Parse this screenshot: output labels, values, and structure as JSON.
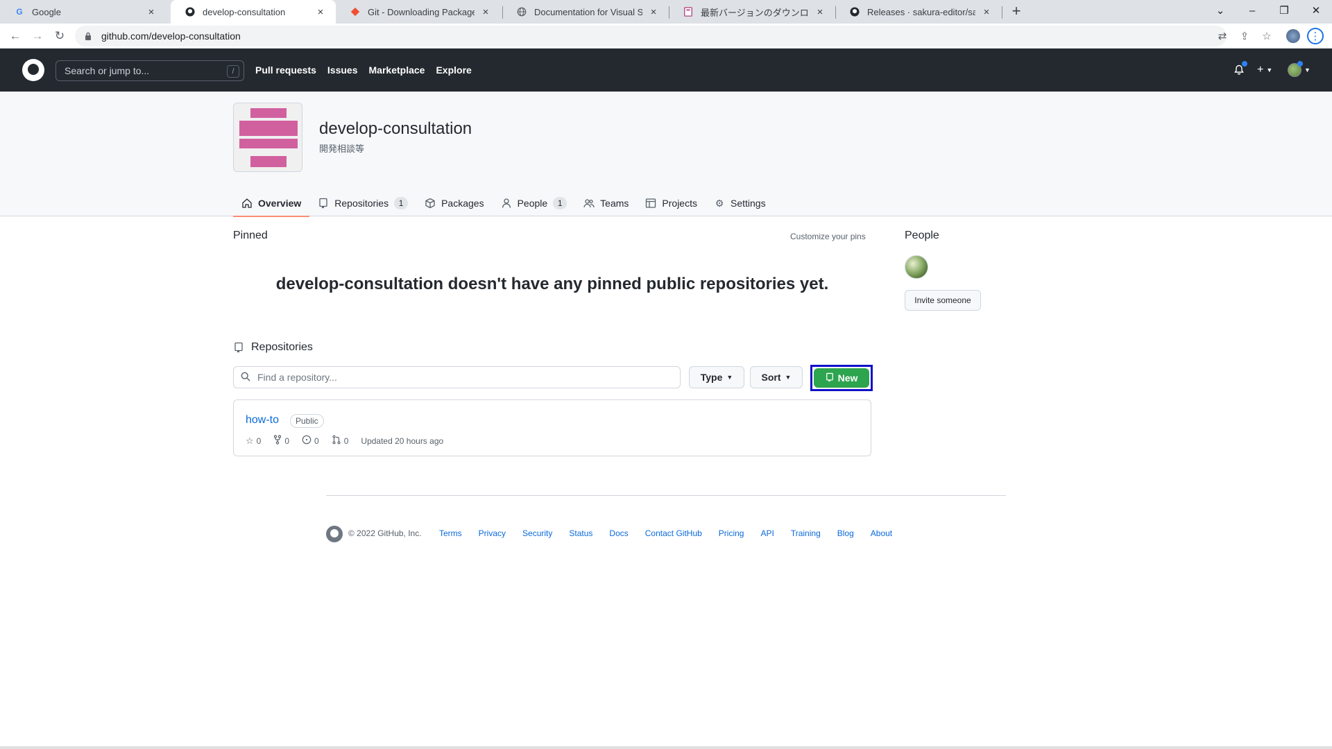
{
  "browser": {
    "tabs": [
      {
        "title": "Google",
        "favicon": "G"
      },
      {
        "title": "develop-consultation",
        "favicon": "github-icon"
      },
      {
        "title": "Git - Downloading Package",
        "favicon": "git-icon"
      },
      {
        "title": "Documentation for Visual Studio",
        "favicon": "globe-icon"
      },
      {
        "title": "最新バージョンのダウンロード",
        "favicon": "page-icon"
      },
      {
        "title": "Releases · sakura-editor/sakura",
        "favicon": "github-icon"
      }
    ],
    "url": "github.com/develop-consultation"
  },
  "header": {
    "search_placeholder": "Search or jump to...",
    "search_shortcut": "/",
    "nav": [
      "Pull requests",
      "Issues",
      "Marketplace",
      "Explore"
    ]
  },
  "org": {
    "name": "develop-consultation",
    "description": "開発相談等",
    "avatar_color": "#d1609f",
    "tabs": [
      {
        "label": "Overview",
        "icon": "home-icon"
      },
      {
        "label": "Repositories",
        "icon": "repo-icon",
        "count": "1"
      },
      {
        "label": "Packages",
        "icon": "package-icon"
      },
      {
        "label": "People",
        "icon": "person-icon",
        "count": "1"
      },
      {
        "label": "Teams",
        "icon": "people-icon"
      },
      {
        "label": "Projects",
        "icon": "table-icon"
      },
      {
        "label": "Settings",
        "icon": "gear-icon"
      }
    ]
  },
  "pinned": {
    "title": "Pinned",
    "customize": "Customize your pins",
    "empty_message": "develop-consultation doesn't have any pinned public repositories yet."
  },
  "repositories": {
    "title": "Repositories",
    "search_placeholder": "Find a repository...",
    "type_label": "Type",
    "sort_label": "Sort",
    "new_label": "New",
    "items": [
      {
        "name": "how-to",
        "visibility": "Public",
        "stars": "0",
        "forks": "0",
        "issues": "0",
        "pulls": "0",
        "updated": "Updated 20 hours ago"
      }
    ]
  },
  "sidebar": {
    "people_title": "People",
    "invite_label": "Invite someone"
  },
  "footer": {
    "copyright": "© 2022 GitHub, Inc.",
    "links": [
      "Terms",
      "Privacy",
      "Security",
      "Status",
      "Docs",
      "Contact GitHub",
      "Pricing",
      "API",
      "Training",
      "Blog",
      "About"
    ]
  },
  "colors": {
    "header_bg": "#24292f",
    "new_button": "#2da44e",
    "highlight_ring": "#0f10c8",
    "link": "#0969da"
  }
}
